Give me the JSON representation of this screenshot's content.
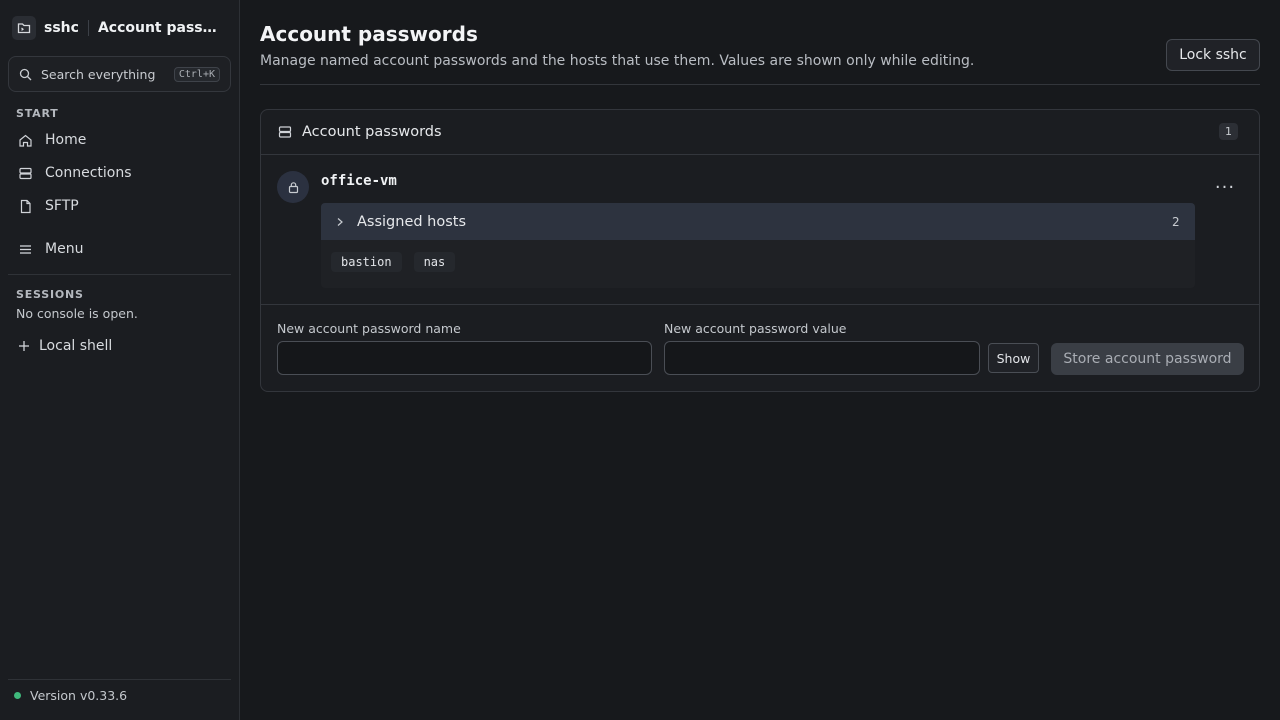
{
  "app": {
    "name": "sshc",
    "page_title": "Account passwords"
  },
  "sidebar": {
    "search": {
      "placeholder": "Search everything",
      "shortcut": "Ctrl+K"
    },
    "start_label": "START",
    "items": [
      {
        "label": "Home",
        "icon": "home-icon"
      },
      {
        "label": "Connections",
        "icon": "server-icon"
      },
      {
        "label": "SFTP",
        "icon": "file-icon"
      },
      {
        "label": "Menu",
        "icon": "menu-icon"
      }
    ],
    "sessions_label": "SESSIONS",
    "sessions_empty": "No console is open.",
    "local_shell": "Local shell",
    "version": "Version v0.33.6"
  },
  "header": {
    "title": "Account passwords",
    "subtitle": "Manage named account passwords and the hosts that use them. Values are shown only while editing.",
    "lock_button": "Lock sshc"
  },
  "card": {
    "title": "Account passwords",
    "count": "1",
    "entries": [
      {
        "name": "office-vm",
        "more": "...",
        "assigned_label": "Assigned hosts",
        "assigned_count": "2",
        "hosts": [
          "bastion",
          "nas"
        ]
      }
    ]
  },
  "form": {
    "name_label": "New account password name",
    "value_label": "New account password value",
    "show_button": "Show",
    "store_button": "Store account password"
  },
  "colors": {
    "accent_status": "#3fb97c",
    "background": "#17191c",
    "sidebar": "#1b1d21"
  }
}
